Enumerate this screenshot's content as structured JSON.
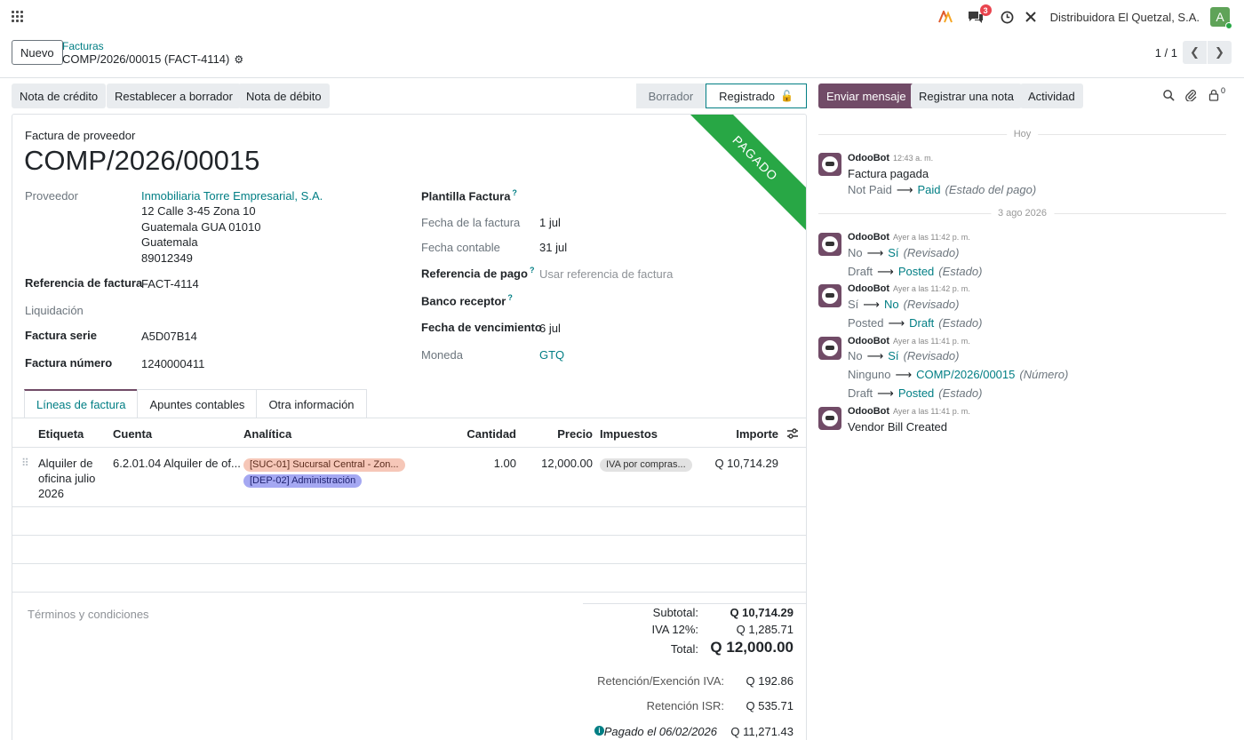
{
  "topbar": {
    "company": "Distribuidora El Quetzal, S.A.",
    "avatar_letter": "A",
    "chat_count": "3"
  },
  "control": {
    "new_label": "Nuevo",
    "breadcrumb_parent": "Facturas",
    "breadcrumb_current": "COMP/2026/00015 (FACT-4114)",
    "pager_value": "1 / 1"
  },
  "statusbar": {
    "buttons": [
      "Nota de crédito",
      "Restablecer a borrador",
      "Nota de débito"
    ],
    "steps": [
      "Borrador",
      "Registrado"
    ]
  },
  "form": {
    "ribbon": "PAGADO",
    "doc_type": "Factura de proveedor",
    "doc_name": "COMP/2026/00015",
    "left": {
      "proveedor_label": "Proveedor",
      "proveedor_name": "Inmobiliaria Torre Empresarial, S.A.",
      "address": [
        "12 Calle 3-45 Zona 10",
        "Guatemala GUA 01010",
        "Guatemala",
        "89012349"
      ],
      "ref_label": "Referencia de factura",
      "ref_value": "FACT-4114",
      "liq_label": "Liquidación",
      "serie_label": "Factura serie",
      "serie_value": "A5D07B14",
      "numero_label": "Factura número",
      "numero_value": "1240000411"
    },
    "right": {
      "plantilla_label": "Plantilla Factura",
      "fecha_factura_label": "Fecha de la factura",
      "fecha_factura_value": "1 jul",
      "fecha_contable_label": "Fecha contable",
      "fecha_contable_value": "31 jul",
      "ref_pago_label": "Referencia de pago",
      "ref_pago_placeholder": "Usar referencia de factura",
      "banco_label": "Banco receptor",
      "vencimiento_label": "Fecha de vencimiento",
      "vencimiento_value": "6 jul",
      "moneda_label": "Moneda",
      "moneda_value": "GTQ"
    },
    "help_mark": "?",
    "tabs": [
      "Líneas de factura",
      "Apuntes contables",
      "Otra información"
    ],
    "columns": [
      "Etiqueta",
      "Cuenta",
      "Analítica",
      "Cantidad",
      "Precio",
      "Impuestos",
      "Importe"
    ],
    "line": {
      "label": [
        "Alquiler de",
        "oficina julio",
        "2026"
      ],
      "account": "6.2.01.04 Alquiler de of...",
      "tag1": "[SUC-01] Sucursal Central - Zon...",
      "tag2": "[DEP-02] Administración",
      "qty": "1.00",
      "price": "12,000.00",
      "tax": "IVA por compras...",
      "amount": "Q 10,714.29"
    },
    "terms_placeholder": "Términos y condiciones",
    "totals": {
      "subtotal_label": "Subtotal:",
      "subtotal_value": "Q 10,714.29",
      "iva_label": "IVA 12%:",
      "iva_value": "Q 1,285.71",
      "total_label": "Total:",
      "total_value": "Q 12,000.00",
      "ret_iva_label": "Retención/Exención IVA:",
      "ret_iva_value": "Q 192.86",
      "ret_isr_label": "Retención ISR:",
      "ret_isr_value": "Q 535.71",
      "paid_label": "Pagado el 06/02/2026",
      "paid_value": "Q 11,271.43"
    }
  },
  "chatter": {
    "send_label": "Enviar mensaje",
    "note_label": "Registrar una nota",
    "activity_label": "Actividad",
    "follower_count": "0",
    "sep_today": "Hoy",
    "sep_date": "3 ago 2026",
    "author": "OdooBot",
    "m1": {
      "date": "12:43 a. m.",
      "body": "Factura pagada",
      "old": "Not Paid",
      "new": "Paid",
      "field": "(Estado del pago)"
    },
    "m2": {
      "date": "Ayer a las 11:42 p. m.",
      "l1_old": "No",
      "l1_new": "Sí",
      "l1_field": "(Revisado)",
      "l2_old": "Draft",
      "l2_new": "Posted",
      "l2_field": "(Estado)"
    },
    "m3": {
      "date": "Ayer a las 11:42 p. m.",
      "l1_old": "Sí",
      "l1_new": "No",
      "l1_field": "(Revisado)",
      "l2_old": "Posted",
      "l2_new": "Draft",
      "l2_field": "(Estado)"
    },
    "m4": {
      "date": "Ayer a las 11:41 p. m.",
      "l1_old": "No",
      "l1_new": "Sí",
      "l1_field": "(Revisado)",
      "l2_old": "Ninguno",
      "l2_new": "COMP/2026/00015",
      "l2_field": "(Número)",
      "l3_old": "Draft",
      "l3_new": "Posted",
      "l3_field": "(Estado)"
    },
    "m5": {
      "date": "Ayer a las 11:41 p. m.",
      "body": "Vendor Bill Created"
    }
  },
  "colors": {
    "brand": "#714b67",
    "link": "#017e84",
    "paid_ribbon": "#28a745"
  }
}
